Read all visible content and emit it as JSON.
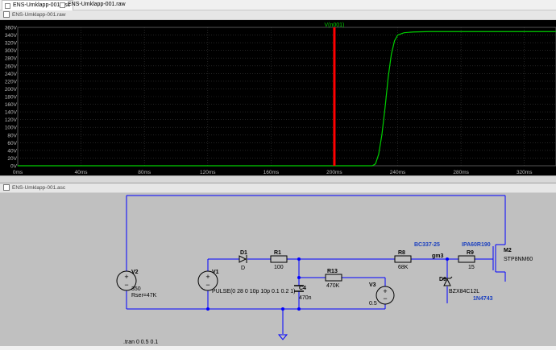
{
  "tabs": [
    {
      "label": "ENS-Umklapp-001.asc",
      "icon": "schematic-file-icon",
      "active": true
    },
    {
      "label": "ENS-Umklapp-001.raw",
      "icon": "waveform-file-icon",
      "active": false
    }
  ],
  "waveform_window": {
    "title": "ENS-Umklapp-001.raw",
    "trace_label": "V(n001)",
    "trace_color": "#00d000",
    "cursor_color": "#ff0000",
    "grid_color": "#3a3a3a"
  },
  "schematic_window": {
    "title": "ENS-Umklapp-001.asc",
    "background": "#c0c0c0",
    "wire_color": "#0000ff",
    "components": {
      "V2": {
        "name": "V2",
        "value": "350",
        "extra": "Rser=47K"
      },
      "V1": {
        "name": "V1",
        "value": "PULSE(0 28 0 10p 10p 0.1 0.2 1)"
      },
      "D1": {
        "name": "D1",
        "value": "D"
      },
      "R1": {
        "name": "R1",
        "value": "100"
      },
      "C4": {
        "name": "C4",
        "value": "470n"
      },
      "R13": {
        "name": "R13",
        "value": "470K"
      },
      "V3": {
        "name": "V3",
        "value": "0.5"
      },
      "R8": {
        "name": "R8",
        "value": "68K",
        "model": "BC337-25"
      },
      "R9": {
        "name": "R9",
        "value": "15",
        "model": "IPA60R190"
      },
      "D9": {
        "name": "D9",
        "value": "BZX84C12L",
        "model": "1N4743"
      },
      "M2": {
        "name": "M2",
        "value": "STP8NM60"
      }
    },
    "net_label": "gm3",
    "directive": ".tran 0 0.5 0.1"
  },
  "chart_data": {
    "type": "line",
    "title": "V(n001)",
    "xlabel": "",
    "ylabel": "",
    "x_ticks": [
      "0ms",
      "40ms",
      "80ms",
      "120ms",
      "160ms",
      "200ms",
      "240ms",
      "280ms",
      "320ms"
    ],
    "y_ticks": [
      "0V",
      "20V",
      "40V",
      "60V",
      "80V",
      "100V",
      "120V",
      "140V",
      "160V",
      "180V",
      "200V",
      "220V",
      "240V",
      "260V",
      "280V",
      "300V",
      "320V",
      "340V",
      "360V"
    ],
    "xlim": [
      0,
      340
    ],
    "ylim": [
      0,
      360
    ],
    "grid": true,
    "cursor_x": 200,
    "series": [
      {
        "name": "V(n001)",
        "x": [
          0,
          100,
          200,
          224,
          226,
          228,
          230,
          232,
          234,
          236,
          238,
          240,
          244,
          250,
          260,
          280,
          300,
          320,
          340
        ],
        "y": [
          0,
          0,
          0,
          0,
          5,
          30,
          80,
          150,
          230,
          290,
          325,
          340,
          346,
          348,
          349,
          349,
          349,
          349,
          349
        ]
      }
    ]
  }
}
